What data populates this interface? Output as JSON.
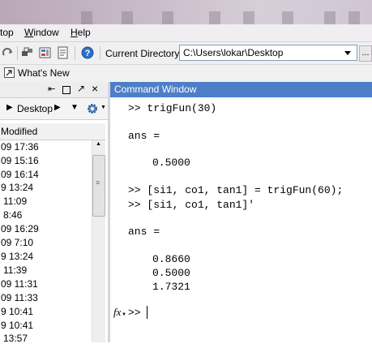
{
  "menu": {
    "items": [
      "top",
      "Window",
      "Help"
    ]
  },
  "toolbar": {
    "current_directory_label": "Current Directory:",
    "current_directory_value": "C:\\Users\\lokar\\Desktop",
    "browse_label": "..."
  },
  "shortcuts": {
    "whats_new": "What's New"
  },
  "file_browser": {
    "path": "Desktop",
    "column_header": "Modified",
    "rows": [
      "09 17:36",
      "09 15:16",
      "09 16:14",
      "9 13:24",
      "11:09",
      "8:46",
      "09 16:29",
      "09 7:10",
      "9 13:24",
      "11:39",
      "09 11:31",
      "09 11:33",
      "9 10:41",
      "9 10:41",
      "13:57"
    ]
  },
  "command_window": {
    "title": "Command Window",
    "lines": [
      ">> trigFun(30)",
      "ans =",
      "0.5000",
      ">> [si1, co1, tan1] = trigFun(60);",
      ">> [si1, co1, tan1]'",
      "ans =",
      "0.8660",
      "0.5000",
      "1.7321"
    ],
    "prompt": ">>",
    "fx": "fx"
  },
  "colors": {
    "command_title_bg": "#4d7fc7",
    "window_chrome": "#f0eef0"
  }
}
